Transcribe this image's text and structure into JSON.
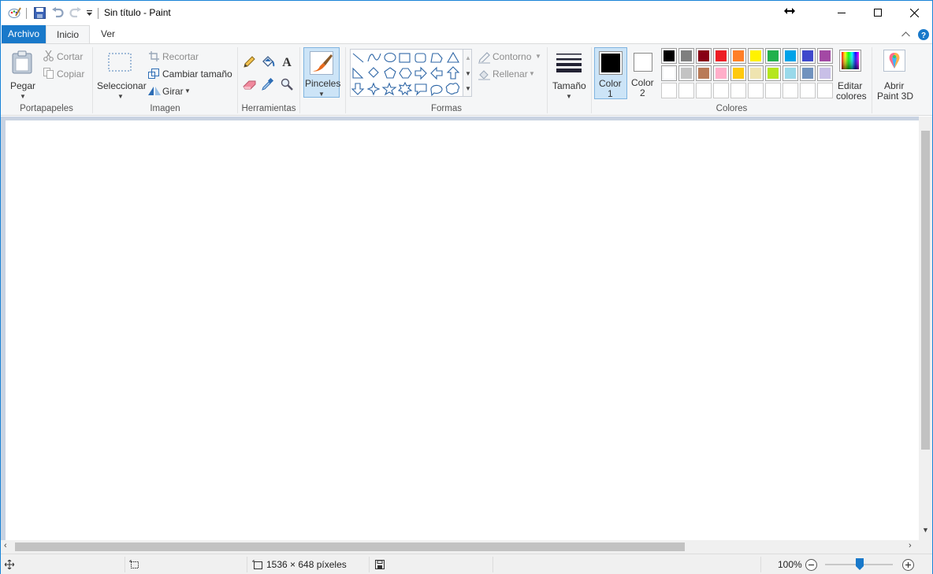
{
  "window": {
    "title": "Sin título - Paint",
    "accent": "#1979ca"
  },
  "tabs": [
    {
      "label": "Archivo"
    },
    {
      "label": "Inicio"
    },
    {
      "label": "Ver"
    }
  ],
  "ribbon": {
    "clipboard": {
      "label": "Portapapeles",
      "paste": "Pegar",
      "cut": "Cortar",
      "copy": "Copiar"
    },
    "image": {
      "label": "Imagen",
      "select": "Seleccionar",
      "crop": "Recortar",
      "resize": "Cambiar tamaño",
      "rotate": "Girar"
    },
    "tools": {
      "label": "Herramientas"
    },
    "brushes": {
      "label": "Pinceles"
    },
    "shapes": {
      "label": "Formas",
      "outline": "Contorno",
      "fill": "Rellenar"
    },
    "size": {
      "label": "Tamaño"
    },
    "colors": {
      "label": "Colores",
      "color1_line1": "Color",
      "color1_line2": "1",
      "color2_line1": "Color",
      "color2_line2": "2",
      "edit_line1": "Editar",
      "edit_line2": "colores",
      "color1_value": "#000000",
      "color2_value": "#ffffff",
      "palette_row1": [
        "#000000",
        "#7f7f7f",
        "#880015",
        "#ed1c24",
        "#ff7f27",
        "#fff200",
        "#22b14c",
        "#00a2e8",
        "#3f48cc",
        "#a349a4"
      ],
      "palette_row2": [
        "#ffffff",
        "#c3c3c3",
        "#b97a57",
        "#ffaec9",
        "#ffc90e",
        "#efe4b0",
        "#b5e61d",
        "#99d9ea",
        "#7092be",
        "#c8bfe7"
      ]
    },
    "paint3d": {
      "line1": "Abrir",
      "line2": "Paint 3D"
    }
  },
  "statusbar": {
    "dimensions": "1536 × 648 píxeles",
    "zoom": "100%"
  }
}
